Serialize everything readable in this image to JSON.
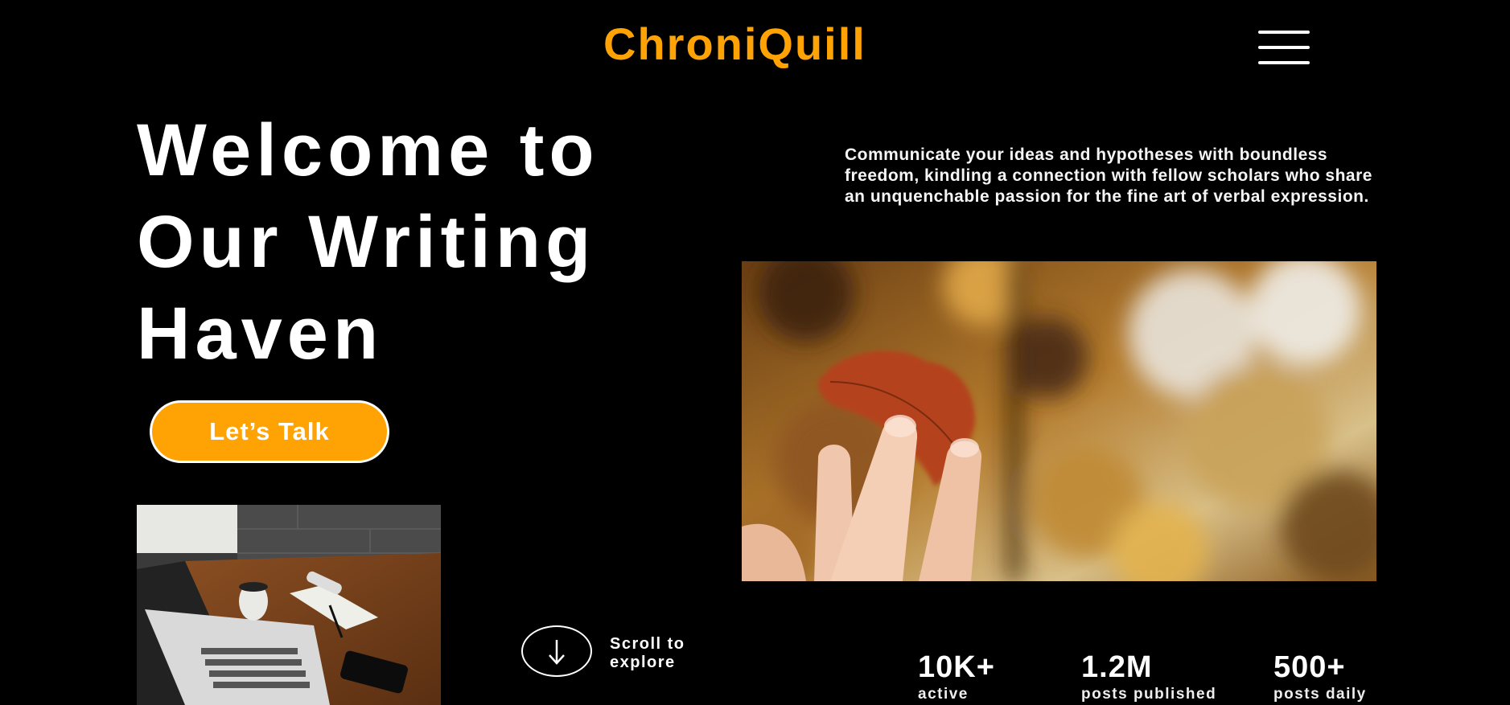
{
  "header": {
    "logo": "ChroniQuill",
    "menu_icon": "hamburger-menu-icon"
  },
  "hero": {
    "title_lines": [
      "Welcome to",
      "Our Writing",
      "Haven"
    ],
    "cta_label": "Let’s Talk",
    "tagline": "Communicate your ideas and hypotheses with boundless freedom, kindling a connection with fellow scholars who share an unquenchable passion for the fine art of verbal expression."
  },
  "scroll": {
    "icon": "arrow-down-icon",
    "label_lines": [
      "Scroll to",
      "explore"
    ]
  },
  "stats": [
    {
      "value": "10K+",
      "label": "active"
    },
    {
      "value": "1.2M",
      "label": "posts published"
    },
    {
      "value": "500+",
      "label": "posts daily"
    }
  ],
  "colors": {
    "accent": "#ffa305",
    "background": "#000000",
    "text": "#ffffff"
  }
}
